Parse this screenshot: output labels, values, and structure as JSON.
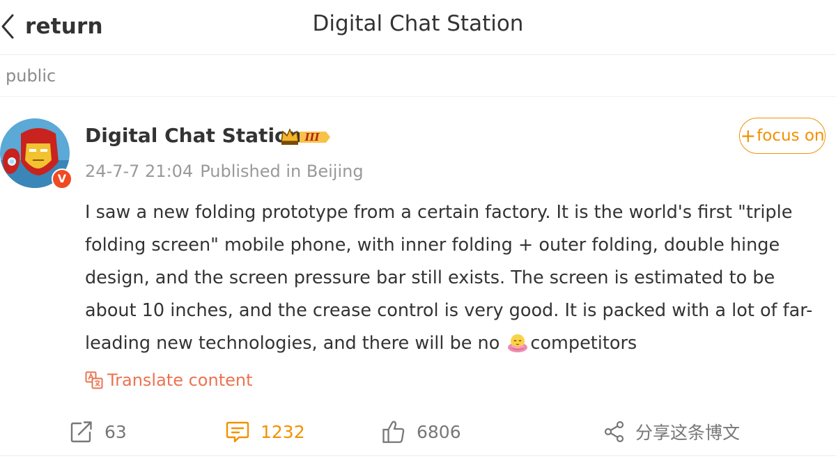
{
  "header": {
    "back_label": "return",
    "title": "Digital Chat Station"
  },
  "section": {
    "label": "public"
  },
  "post": {
    "author_name": "Digital Chat Station",
    "badge_text": "III",
    "verified_mark": "V",
    "date": "24-7-7 21:04",
    "published_in": "Published in Beijing",
    "follow_label": "focus on",
    "follow_plus": "+",
    "text_main": "I saw a new folding prototype from a certain factory. It is the world's first \"triple folding screen\" mobile phone, with inner folding + outer folding, double hinge design, and the screen pressure bar still exists. The screen is estimated to be about 10 inches, and the crease control is very good. It is packed with a lot of far-leading new technologies, and there will be no ",
    "text_tail": "competitors",
    "translate_label": "Translate content"
  },
  "actions": {
    "repost_count": "63",
    "comment_count": "1232",
    "like_count": "6806",
    "share_label": "分享这条博文"
  },
  "colors": {
    "accent_orange": "#f29100",
    "translate_orange": "#eb7350",
    "verified_red": "#f04a23"
  },
  "icons": {
    "back": "chevron-left-icon",
    "badge": "crown-badge-icon",
    "translate": "translate-icon",
    "emoji": "flower-emoji-icon",
    "repost": "repost-icon",
    "comment": "comment-icon",
    "like": "thumbs-up-icon",
    "share": "share-icon"
  }
}
